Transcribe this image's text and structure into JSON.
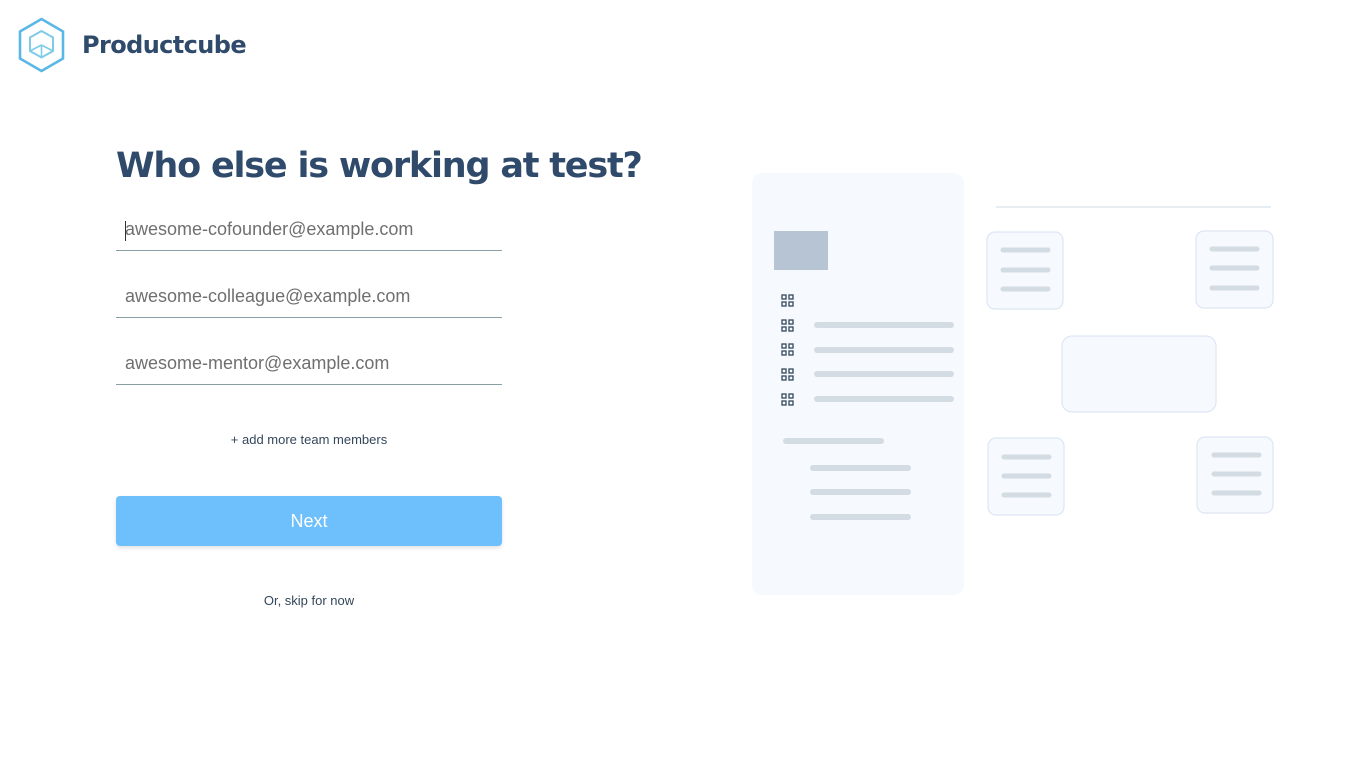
{
  "app": {
    "brand_name": "Productcube",
    "logo_icon": "cube-hexagon-icon",
    "brand_color": "#2f4a6b",
    "accent_color": "#6ec0fc"
  },
  "onboarding": {
    "heading": "Who else is working at test?",
    "fields": [
      {
        "placeholder": "awesome-cofounder@example.com",
        "value": ""
      },
      {
        "placeholder": "awesome-colleague@example.com",
        "value": ""
      },
      {
        "placeholder": "awesome-mentor@example.com",
        "value": ""
      }
    ],
    "add_more_label": "+ add more team members",
    "next_label": "Next",
    "skip_label": "Or, skip for now"
  },
  "illustration": {
    "list_item_icon": "grid-icon"
  }
}
